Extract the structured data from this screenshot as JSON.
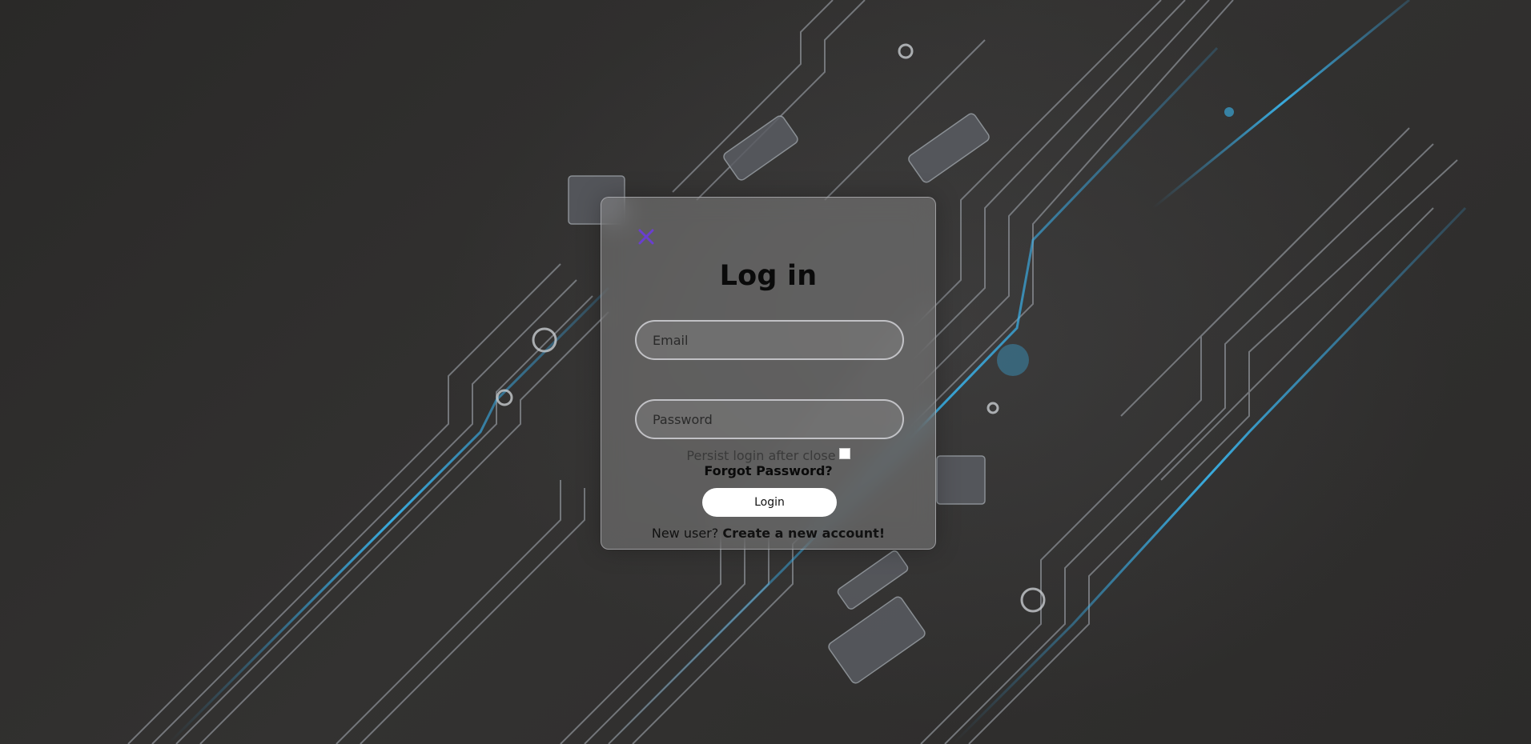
{
  "modal": {
    "title": "Log in",
    "email_placeholder": "Email",
    "password_placeholder": "Password",
    "persist_label": "Persist login after close",
    "forgot_label": "Forgot Password?",
    "login_button": "Login",
    "new_user_text": "New user?",
    "create_account_link": "Create a new account!"
  },
  "icons": {
    "close": "close-icon"
  },
  "colors": {
    "close_icon": "#6a3fd0",
    "accent_trace": "#3aa8e8",
    "button_bg": "#ffffff"
  }
}
